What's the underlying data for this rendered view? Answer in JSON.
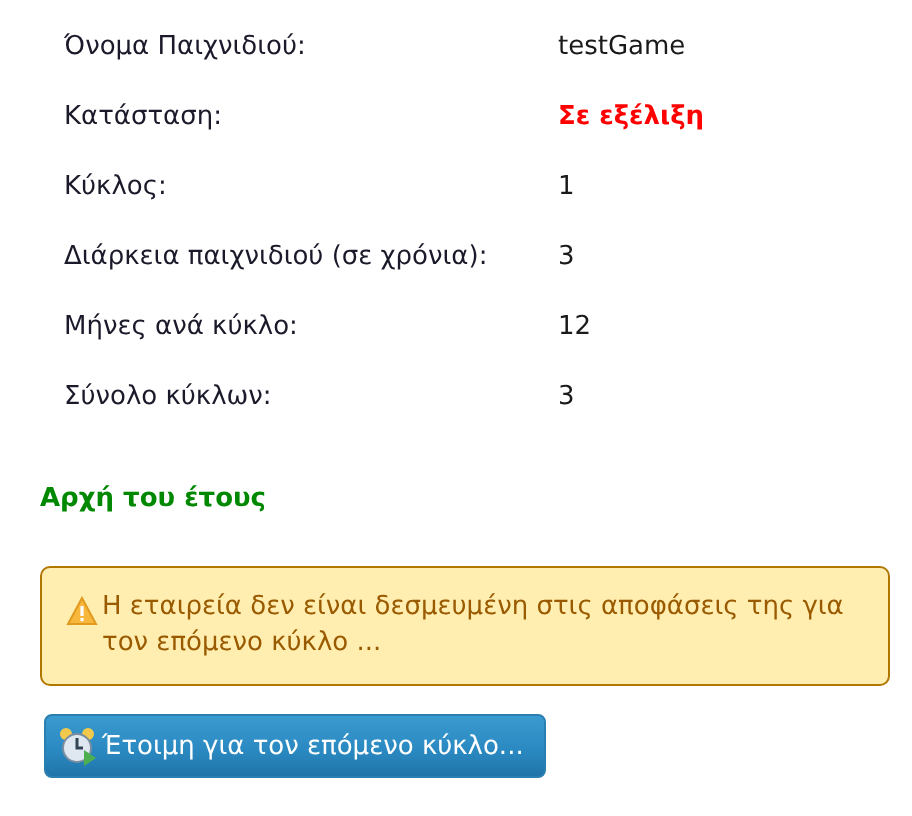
{
  "details": [
    {
      "label": "Όνομα Παιχνιδιού:",
      "value": "testGame",
      "kind": "plain"
    },
    {
      "label": "Κατάσταση:",
      "value": "Σε εξέλιξη",
      "kind": "status"
    },
    {
      "label": "Κύκλος:",
      "value": "1",
      "kind": "plain"
    },
    {
      "label": "Διάρκεια παιχνιδιού (σε χρόνια):",
      "value": "3",
      "kind": "plain"
    },
    {
      "label": "Μήνες ανά κύκλο:",
      "value": "12",
      "kind": "plain"
    },
    {
      "label": "Σύνολο κύκλων:",
      "value": "3",
      "kind": "plain"
    }
  ],
  "period": "Αρχή του έτους",
  "warning": "Η εταιρεία δεν είναι δεσμευμένη στις αποφάσεις της για τον επόμενο κύκλο ...",
  "ready_button": "Έτοιμη για τον επόμενο κύκλο..."
}
